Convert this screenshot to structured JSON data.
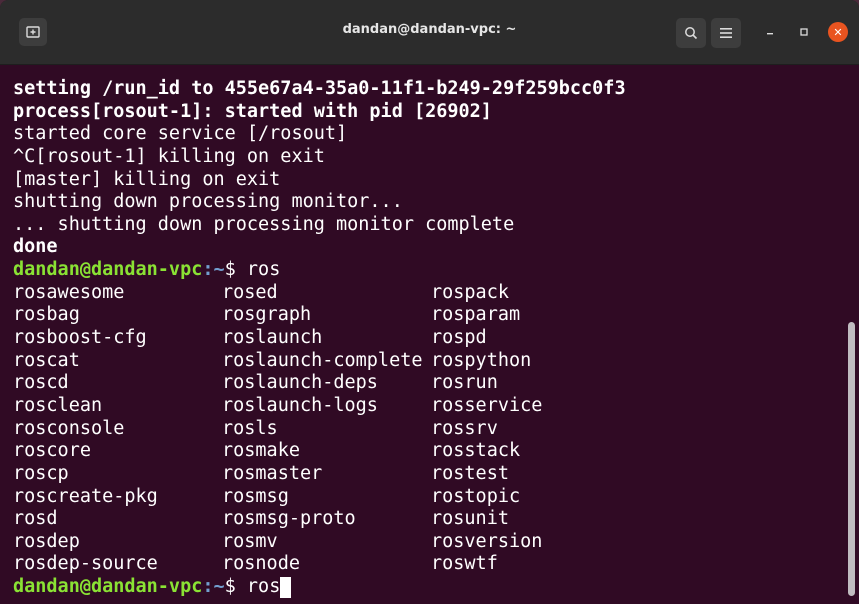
{
  "window": {
    "title": "dandan@dandan-vpc: ~"
  },
  "terminal": {
    "output_lines": [
      {
        "text": "setting /run_id to 455e67a4-35a0-11f1-b249-29f259bcc0f3",
        "bold": true
      },
      {
        "text": "process[rosout-1]: started with pid [26902]",
        "bold": true
      },
      {
        "text": "started core service [/rosout]",
        "bold": false
      },
      {
        "text": "^C[rosout-1] killing on exit",
        "bold": false
      },
      {
        "text": "[master] killing on exit",
        "bold": false
      },
      {
        "text": "shutting down processing monitor...",
        "bold": false
      },
      {
        "text": "... shutting down processing monitor complete",
        "bold": false
      },
      {
        "text": "done",
        "bold": true
      }
    ],
    "prompt": {
      "user_host": "dandan@dandan-vpc",
      "separator": ":",
      "path": "~",
      "symbol": "$ "
    },
    "first_command": "ros",
    "completions": [
      "rosawesome",
      "rosed",
      "rospack",
      "rosbag",
      "rosgraph",
      "rosparam",
      "rosboost-cfg",
      "roslaunch",
      "rospd",
      "roscat",
      "roslaunch-complete",
      "rospython",
      "roscd",
      "roslaunch-deps",
      "rosrun",
      "rosclean",
      "roslaunch-logs",
      "rosservice",
      "rosconsole",
      "rosls",
      "rossrv",
      "roscore",
      "rosmake",
      "rosstack",
      "roscp",
      "rosmaster",
      "rostest",
      "roscreate-pkg",
      "rosmsg",
      "rostopic",
      "rosd",
      "rosmsg-proto",
      "rosunit",
      "rosdep",
      "rosmv",
      "rosversion",
      "rosdep-source",
      "rosnode",
      "roswtf"
    ],
    "current_input": "ros"
  },
  "colors": {
    "background": "#300a24",
    "prompt_user": "#8ae234",
    "prompt_path": "#729fcf",
    "close_button": "#e95420"
  }
}
